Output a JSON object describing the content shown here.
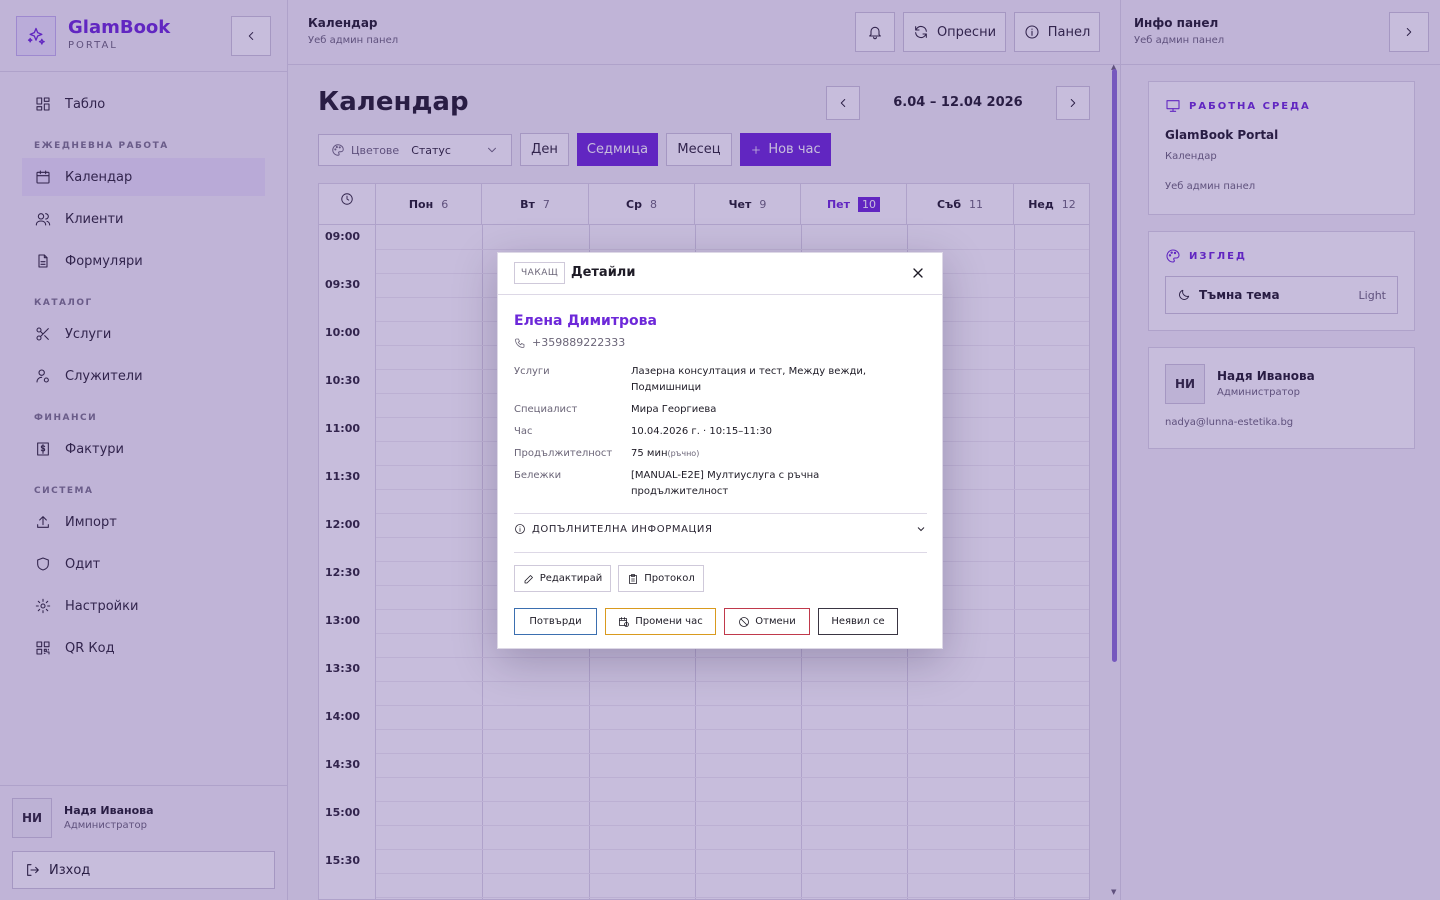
{
  "brand": {
    "name": "GlamBook",
    "sub": "PORTAL"
  },
  "nav": {
    "dashboard": "Табло",
    "group_daily": "ЕЖЕДНЕВНА РАБОТА",
    "calendar": "Календар",
    "clients": "Клиенти",
    "forms": "Формуляри",
    "group_catalog": "КАТАЛОГ",
    "services": "Услуги",
    "employees": "Служители",
    "group_finance": "ФИНАНСИ",
    "invoices": "Фактури",
    "group_system": "СИСТЕМА",
    "import": "Импорт",
    "audit": "Одит",
    "settings": "Настройки",
    "qr": "QR Код"
  },
  "sidebar_user": {
    "initials": "НИ",
    "name": "Надя Иванова",
    "role": "Администратор",
    "logout": "Изход"
  },
  "header": {
    "title": "Календар",
    "subtitle": "Уеб админ панел",
    "refresh": "Опресни",
    "panel": "Панел"
  },
  "page": {
    "title": "Календар",
    "date_range": "6.04 – 12.04 2026",
    "colors_label": "Цветове",
    "colors_value": "Статус",
    "view_day": "Ден",
    "view_week": "Седмица",
    "view_month": "Месец",
    "new_appointment": "Нов час"
  },
  "calendar": {
    "days": [
      {
        "name": "Пон",
        "num": "6",
        "today": false
      },
      {
        "name": "Вт",
        "num": "7",
        "today": false
      },
      {
        "name": "Ср",
        "num": "8",
        "today": false
      },
      {
        "name": "Чет",
        "num": "9",
        "today": false
      },
      {
        "name": "Пет",
        "num": "10",
        "today": true
      },
      {
        "name": "Съб",
        "num": "11",
        "today": false
      },
      {
        "name": "Нед",
        "num": "12",
        "today": false
      }
    ],
    "times": [
      "09:00",
      "09:30",
      "10:00",
      "10:30",
      "11:00",
      "11:30",
      "12:00",
      "12:30",
      "13:00",
      "13:30",
      "14:00",
      "14:30",
      "15:00",
      "15:30"
    ]
  },
  "info_panel": {
    "title": "Инфо панел",
    "subtitle": "Уеб админ панел",
    "workspace_head": "РАБОТНА СРЕДА",
    "workspace_name": "GlamBook Portal",
    "workspace_page": "Календар",
    "workspace_sub": "Уеб админ панел",
    "appearance_head": "ИЗГЛЕД",
    "theme_label": "Тъмна тема",
    "theme_value": "Light",
    "user_initials": "НИ",
    "user_name": "Надя Иванова",
    "user_role": "Администратор",
    "user_email": "nadya@lunna-estetika.bg"
  },
  "modal": {
    "status": "ЧАКАЩ",
    "title": "Детайли",
    "client_name": "Елена Димитрова",
    "client_phone": "+359889222333",
    "labels": {
      "services": "Услуги",
      "specialist": "Специалист",
      "time": "Час",
      "duration": "Продължителност",
      "notes": "Бележки"
    },
    "values": {
      "services": "Лазерна консултация и тест, Между вежди, Подмишници",
      "specialist": "Мира Георгиева",
      "time": "10.04.2026 г. · 10:15–11:30",
      "duration": "75 мин",
      "duration_note": "(ръчно)",
      "notes": "[MANUAL-E2E] Мултиуслуга с ръчна продължителност"
    },
    "more_info": "ДОПЪЛНИТЕЛНА ИНФОРМАЦИЯ",
    "edit": "Редактирай",
    "protocol": "Протокол",
    "confirm": "Потвърди",
    "reschedule": "Промени час",
    "cancel": "Отмени",
    "no_show": "Неявил се"
  }
}
